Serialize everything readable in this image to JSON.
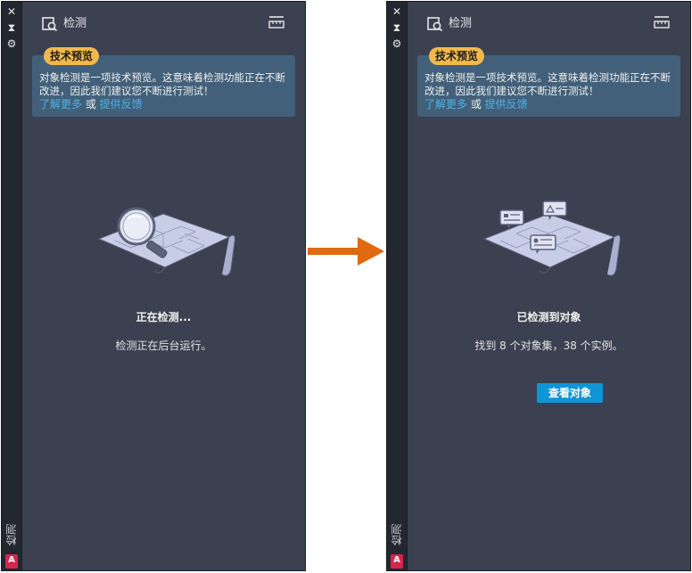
{
  "left_panel": {
    "strip": {
      "close": "✕",
      "pin": "⧗",
      "settings": "⚙",
      "title": "检测",
      "app_logo": "A"
    },
    "header": {
      "title": "检测"
    },
    "banner": {
      "badge": "技术预览",
      "text": "对象检测是一项技术预览。这意味着检测功能正在不断改进，因此我们建议您不断进行测试！",
      "learn_more": "了解更多",
      "or": " 或 ",
      "feedback": "提供反馈"
    },
    "status": "正在检测...",
    "sub": "检测正在后台运行。"
  },
  "right_panel": {
    "strip": {
      "close": "✕",
      "pin": "⧗",
      "settings": "⚙",
      "title": "检测",
      "app_logo": "A"
    },
    "header": {
      "title": "检测"
    },
    "banner": {
      "badge": "技术预览",
      "text": "对象检测是一项技术预览。这意味着检测功能正在不断改进，因此我们建议您不断进行测试！",
      "learn_more": "了解更多",
      "or": " 或 ",
      "feedback": "提供反馈"
    },
    "status": "已检测到对象",
    "sub": "找到 8 个对象集，38 个实例。",
    "button": "查看对象"
  },
  "colors": {
    "arrow": "#e06a0f",
    "badge": "#f3b84c",
    "link": "#4fb1e8",
    "button": "#0f95d6"
  }
}
